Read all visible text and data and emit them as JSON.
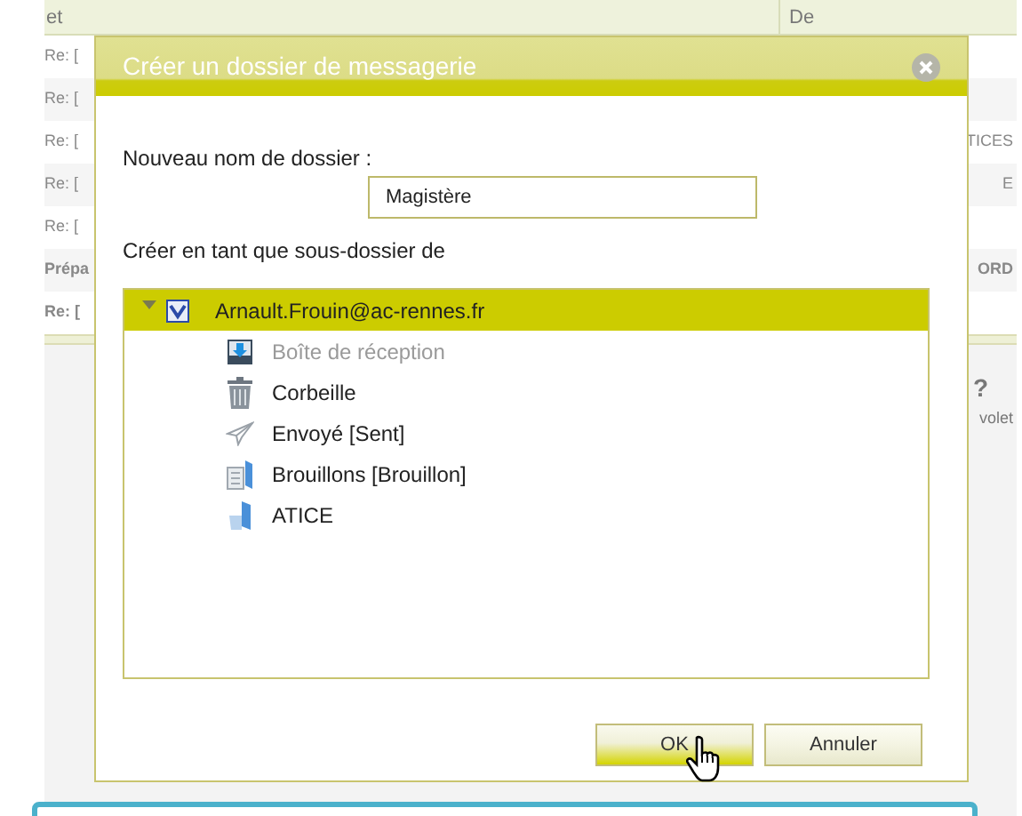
{
  "background": {
    "columns": [
      "et",
      "De"
    ],
    "rows": [
      {
        "subject": "Re: [",
        "bold": false
      },
      {
        "subject": "Re: [",
        "bold": false
      },
      {
        "subject": "Re: [",
        "sender": "TICES",
        "bold": false
      },
      {
        "subject": "Re: [",
        "sender": "E",
        "bold": false
      },
      {
        "subject": "Re: [",
        "bold": false
      },
      {
        "subject": "Prépa",
        "sender": "ORD",
        "bold": true
      },
      {
        "subject": "Re: [",
        "bold": true
      }
    ],
    "help_title": "?",
    "help_text": "volet"
  },
  "dialog": {
    "title": "Créer un dossier de messagerie",
    "name_label": "Nouveau nom de dossier :",
    "name_value": "Magistère",
    "parent_label": "Créer en tant que sous-dossier de",
    "tree": {
      "label": "Arnault.Frouin@ac-rennes.fr",
      "expanded": true,
      "selected": true,
      "children": [
        {
          "label": "Boîte de réception",
          "kind": "inbox",
          "disabled": true
        },
        {
          "label": "Corbeille",
          "kind": "trash",
          "disabled": false
        },
        {
          "label": "Envoyé [Sent]",
          "kind": "sent",
          "disabled": false
        },
        {
          "label": "Brouillons [Brouillon]",
          "kind": "drafts",
          "disabled": false
        },
        {
          "label": "ATICE",
          "kind": "folder",
          "disabled": false
        }
      ]
    },
    "buttons": [
      {
        "label": "OK",
        "highlighted": true
      },
      {
        "label": "Annuler",
        "highlighted": false
      }
    ]
  }
}
